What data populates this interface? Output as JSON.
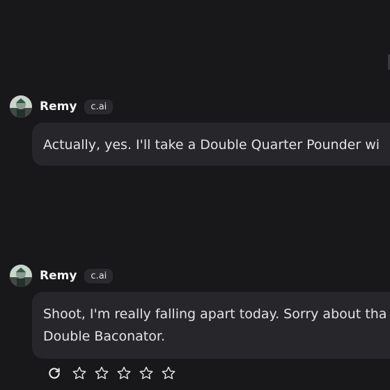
{
  "messages": [
    {
      "author": "Remy",
      "badge": "c.ai",
      "avatar_icon": "avatar-remy",
      "lines": [
        "Actually, yes. I'll take a Double Quarter Pounder wi"
      ]
    },
    {
      "author": "Remy",
      "badge": "c.ai",
      "avatar_icon": "avatar-remy",
      "lines": [
        "Shoot, I'm really falling apart today. Sorry about tha",
        "Double Baconator."
      ]
    }
  ],
  "actions": {
    "regenerate_icon": "refresh-icon",
    "rating_icon": "star-icon",
    "rating_stars": 5,
    "rating_value": 0
  },
  "colors": {
    "background": "#18181b",
    "bubble": "#26262b",
    "badge": "#2a2a2e",
    "text": "#e4e4e7"
  }
}
